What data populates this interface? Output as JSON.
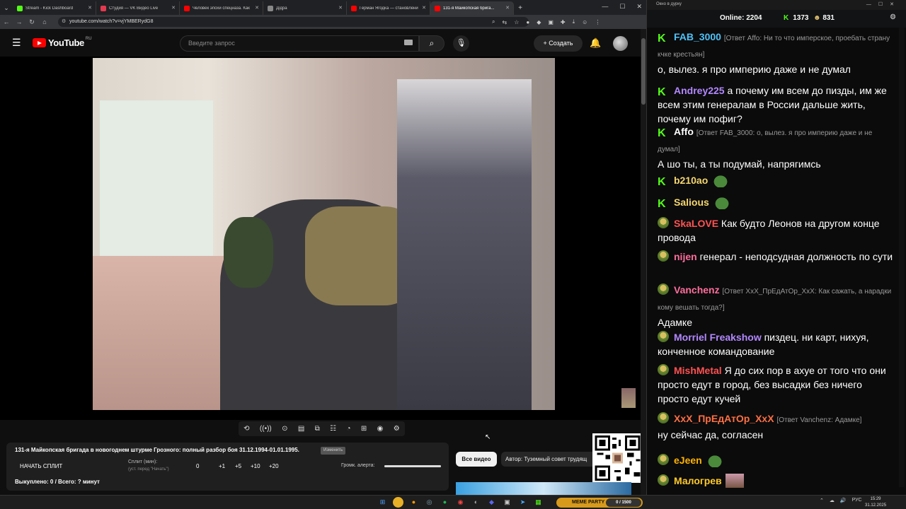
{
  "browser": {
    "tabs": [
      {
        "title": "Stream - Kick Dashboard",
        "color": "#53fc18"
      },
      {
        "title": "Студия — VK Видео Live",
        "color": "#e53950"
      },
      {
        "title": "Человек эпохи спецназа. Как",
        "color": "#ff0000"
      },
      {
        "title": "Дідра",
        "color": "#888888"
      },
      {
        "title": "Герман Ягодка — становлени",
        "color": "#ff0000"
      },
      {
        "title": "131-я Майкопская брига...",
        "color": "#ff0000"
      }
    ],
    "url": "youtube.com/watch?v=vjYMBERydG8"
  },
  "youtube": {
    "logo_text": "YouTube",
    "region": "RU",
    "search_placeholder": "Введите запрос",
    "create_label": "Создать"
  },
  "panel": {
    "title": "131-я Майкопская бригада в новогоднем штурме Грозного: полный разбор боя 31.12.1994-01.01.1995.",
    "tag": "Изменить",
    "start_split": "НАЧАТЬ СПЛИТ",
    "split_label": "Сплит (мин):",
    "split_hint": "(уст. перед \"Начать\")",
    "split_value": "0",
    "split_buttons": [
      "+1",
      "+5",
      "+10",
      "+20"
    ],
    "volume_label": "Громк. алерта:",
    "volume_level": 1.0,
    "bought": "Выкуплено: 0 / Всего: ? минут"
  },
  "chips": {
    "all_videos": "Все видео",
    "author": "Автор: Туземный совет трудящ"
  },
  "kick": {
    "window_title": "Окно в дурку",
    "online_label": "Online:",
    "online_value": "2204",
    "kick_count": "1373",
    "coin_count": "831",
    "accent": "#53fc18",
    "messages": [
      {
        "user": "FAB_3000",
        "color": "#4fc3f7",
        "badge": "kick",
        "reply": "[Ответ Affo: Ни то что имперское, проебать страну кчке крестьян]",
        "text": "о, вылез. я про империю даже и не думал"
      },
      {
        "user": "Andrey225",
        "color": "#b388ff",
        "badge": "kick",
        "reply": "",
        "text": "а почему им всем до пизды, им же всем этим генералам в России дальше жить, почему им пофиг?"
      },
      {
        "user": "Affo",
        "color": "#ffffff",
        "badge": "kick",
        "reply": "[Ответ FAB_3000: о, вылез. я про империю даже и не думал]",
        "text": "А шо ты, а ты подумай, напрягимсь"
      },
      {
        "user": "b210ao",
        "color": "#f5d76e",
        "badge": "kick",
        "reply": "",
        "text": ""
      },
      {
        "user": "Salious",
        "color": "#f5d76e",
        "badge": "kick",
        "reply": "",
        "text": ""
      },
      {
        "user": "SkaLOVE",
        "color": "#ff5252",
        "badge": "frog",
        "reply": "",
        "text": "Как будто Леонов на другом конце провода"
      },
      {
        "user": "nijen",
        "color": "#ff6e9c",
        "badge": "frog",
        "reply": "",
        "text": "генерал - неподсудная должность по сути"
      },
      {
        "user": "Vanchenz",
        "color": "#ff6e9c",
        "badge": "frog",
        "reply": "[Ответ XxX_ПрЕдАтОр_XxX: Как сажать, а нарадки кому вешать тогда?]",
        "text": "Адамке"
      },
      {
        "user": "Morriel Freakshow",
        "color": "#b388ff",
        "badge": "frog",
        "reply": "",
        "text": "пиздец. ни карт, нихуя, конченное командование"
      },
      {
        "user": "MishMetal",
        "color": "#ff5252",
        "badge": "frog",
        "reply": "",
        "text": "Я до сих пор в ахуе от того что они просто едут в город, без высадки без ничего просто едут кучей"
      },
      {
        "user": "XxX_ПрЕдАтОр_XxX",
        "color": "#ff7043",
        "badge": "frog",
        "reply": "[Ответ Vanchenz: Адамке]",
        "text": "ну сейчас да, согласен"
      },
      {
        "user": "eJeen",
        "color": "#ffb300",
        "badge": "frog",
        "reply": "",
        "text": ""
      },
      {
        "user": "Малогрев",
        "color": "#ffca28",
        "badge": "frog",
        "reply": "",
        "text": ""
      }
    ]
  },
  "taskbar": {
    "lang": "РУС",
    "time": "15:29",
    "date": "31.12.2025",
    "widget": "MEME PARTY",
    "widget_progress": "0 / 1500"
  }
}
